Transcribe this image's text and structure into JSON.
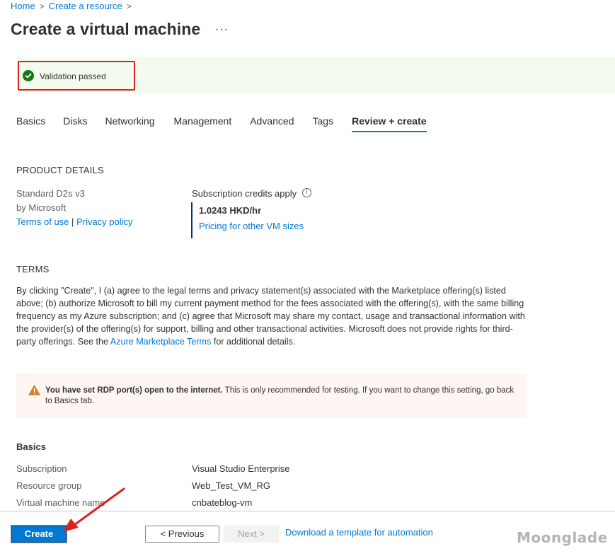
{
  "breadcrumb": {
    "items": [
      "Home",
      "Create a resource"
    ],
    "separator": ">"
  },
  "header": {
    "title": "Create a virtual machine",
    "more_label": "···"
  },
  "validation": {
    "text": "Validation passed",
    "status_color": "#107c10"
  },
  "tabs": [
    {
      "label": "Basics",
      "active": false
    },
    {
      "label": "Disks",
      "active": false
    },
    {
      "label": "Networking",
      "active": false
    },
    {
      "label": "Management",
      "active": false
    },
    {
      "label": "Advanced",
      "active": false
    },
    {
      "label": "Tags",
      "active": false
    },
    {
      "label": "Review + create",
      "active": true
    }
  ],
  "product_details": {
    "heading": "PRODUCT DETAILS",
    "product_name": "Standard D2s v3",
    "publisher": "by Microsoft",
    "terms_link": "Terms of use",
    "divider": "|",
    "privacy_link": "Privacy policy",
    "credits_label": "Subscription credits apply",
    "info_icon": "i",
    "price": "1.0243 HKD/hr",
    "pricing_link": "Pricing for other VM sizes"
  },
  "terms": {
    "heading": "TERMS",
    "body_before_link": "By clicking \"Create\", I (a) agree to the legal terms and privacy statement(s) associated with the Marketplace offering(s) listed above; (b) authorize Microsoft to bill my current payment method for the fees associated with the offering(s), with the same billing frequency as my Azure subscription; and (c) agree that Microsoft may share my contact, usage and transactional information with the provider(s) of the offering(s) for support, billing and other transactional activities. Microsoft does not provide rights for third-party offerings. See the ",
    "link": "Azure Marketplace Terms",
    "body_after_link": " for additional details."
  },
  "warning": {
    "bold": "You have set RDP port(s) open to the internet.",
    "text": " This is only recommended for testing.  If you want to change this setting, go back to Basics tab.",
    "icon_color": "#d83b01"
  },
  "basics": {
    "heading": "Basics",
    "rows": [
      {
        "label": "Subscription",
        "value": "Visual Studio Enterprise"
      },
      {
        "label": "Resource group",
        "value": "Web_Test_VM_RG"
      },
      {
        "label": "Virtual machine name",
        "value": "cnbateblog-vm"
      }
    ]
  },
  "footer": {
    "create_label": "Create",
    "previous_label": "< Previous",
    "next_label": "Next >",
    "download_link": "Download a template for automation"
  },
  "watermark": "Moonglade",
  "colors": {
    "accent": "#0078d4",
    "annotation_red": "#e01f1f"
  }
}
